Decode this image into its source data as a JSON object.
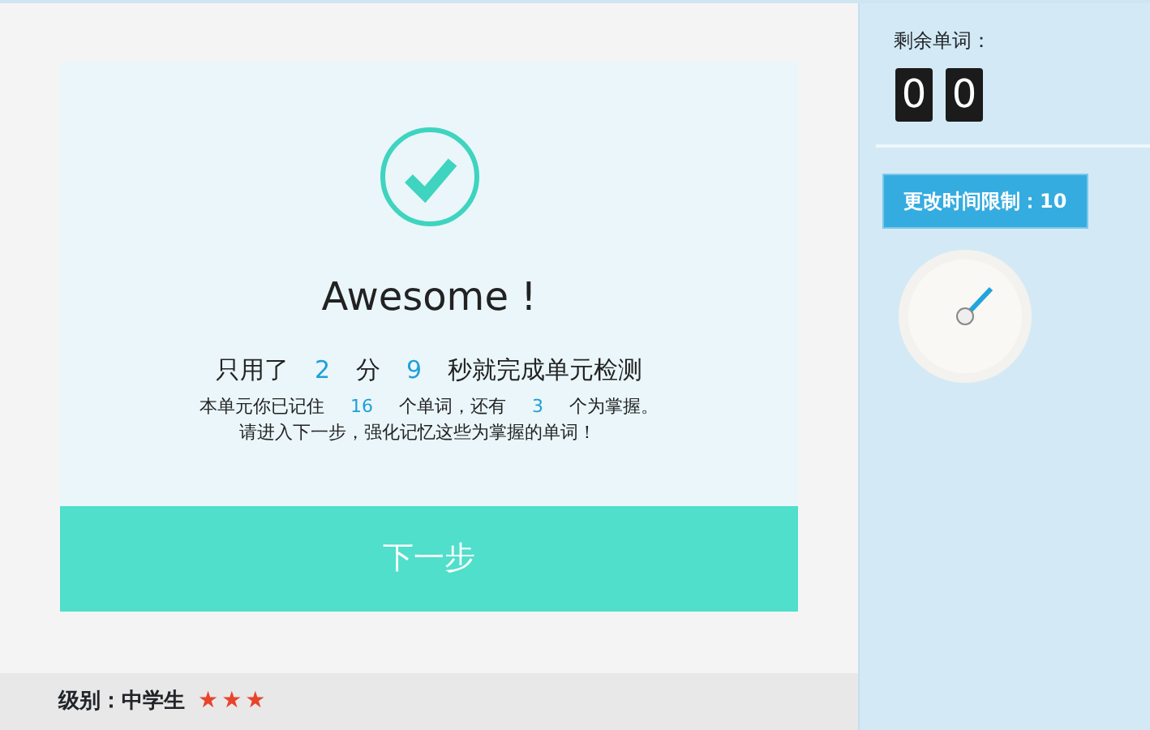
{
  "result": {
    "title": "Awesome !",
    "time_line": [
      "只用了",
      "2",
      "分",
      "9",
      "秒就完成单元检测"
    ],
    "count_line": [
      "本单元你已记住",
      "16",
      "个单词，还有",
      "3",
      "个为掌握。"
    ],
    "hint": "请进入下一步，强化记忆这些为掌握的单词！",
    "next_button": "下一步"
  },
  "level": {
    "label": "级别：中学生",
    "stars": 3
  },
  "sidebar": {
    "remaining_label": "剩余单词：",
    "digits": [
      "0",
      "0"
    ],
    "time_limit_button": "更改时间限制：10"
  }
}
